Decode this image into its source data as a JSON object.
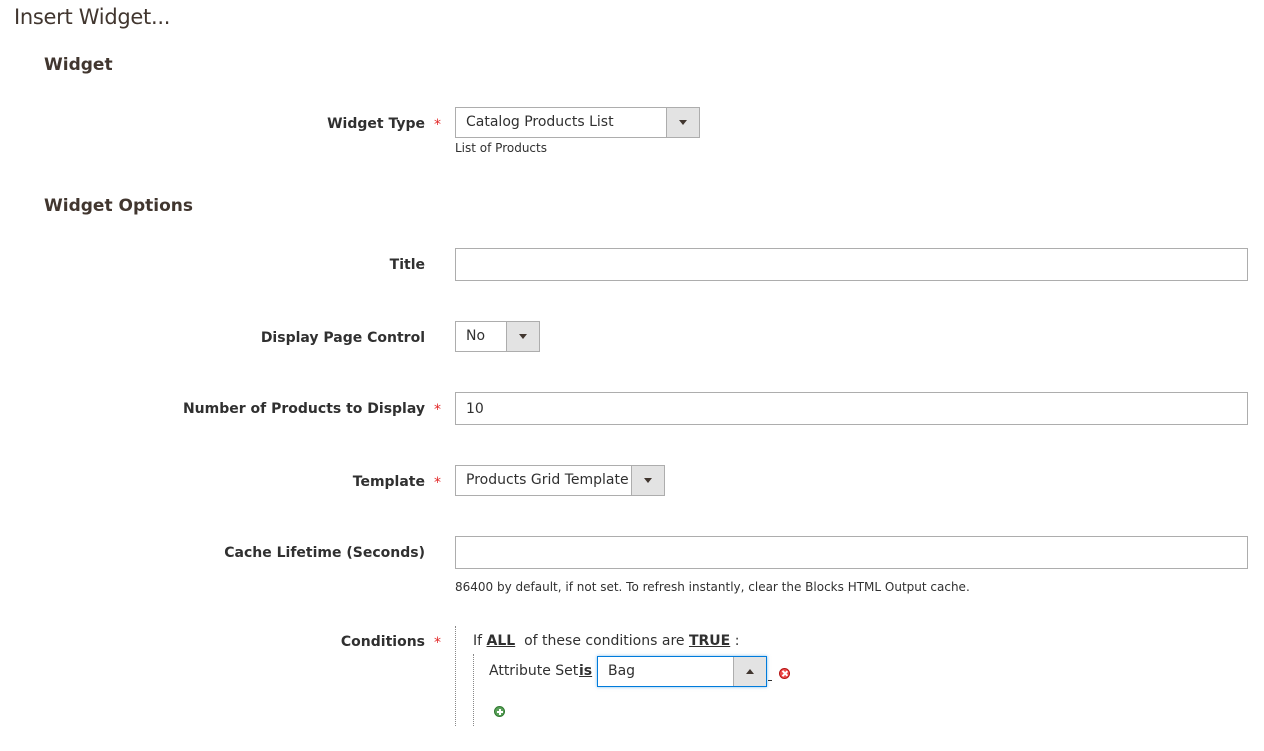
{
  "page": {
    "title": "Insert Widget..."
  },
  "sections": {
    "widget": "Widget",
    "widget_options": "Widget Options"
  },
  "fields": {
    "widget_type": {
      "label": "Widget Type",
      "required": "*",
      "value": "Catalog Products List",
      "note": "List of Products"
    },
    "title": {
      "label": "Title",
      "value": ""
    },
    "display_page_control": {
      "label": "Display Page Control",
      "value": "No"
    },
    "products_count": {
      "label": "Number of Products to Display",
      "required": "*",
      "value": "10"
    },
    "template": {
      "label": "Template",
      "required": "*",
      "value": "Products Grid Template"
    },
    "cache_lifetime": {
      "label": "Cache Lifetime (Seconds)",
      "value": "",
      "note": "86400 by default, if not set. To refresh instantly, clear the Blocks HTML Output cache."
    },
    "conditions": {
      "label": "Conditions",
      "required": "*",
      "prefix": "If",
      "aggregator": "ALL",
      "middle": "of these conditions are",
      "value": "TRUE",
      "suffix": ":",
      "rule": {
        "attribute": "Attribute Set",
        "operator": "is",
        "value": "Bag"
      }
    }
  },
  "icons": {
    "dropdown": "chevron-down-icon",
    "dropdown_open": "chevron-up-icon",
    "remove": "remove-condition-icon",
    "add": "add-condition-icon"
  },
  "colors": {
    "required": "#e22626",
    "focus": "#007bdb",
    "remove": "#ef4a4a",
    "add": "#5aa05a"
  }
}
